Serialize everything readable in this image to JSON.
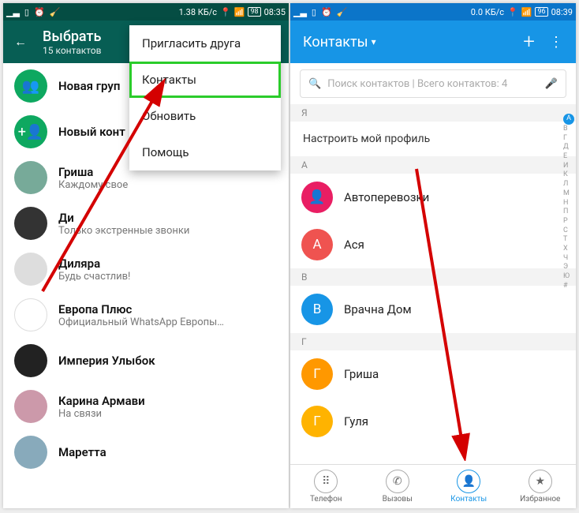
{
  "left": {
    "status": {
      "speed": "1.38 КБ/с",
      "battery": "98",
      "time": "08:35"
    },
    "header": {
      "title": "Выбрать",
      "subtitle": "15 контактов"
    },
    "menu": [
      "Пригласить друга",
      "Контакты",
      "Обновить",
      "Помощь"
    ],
    "rows": [
      {
        "name": "Новая груп",
        "status": "",
        "icon": "group"
      },
      {
        "name": "Новый конт",
        "status": "",
        "icon": "add"
      },
      {
        "name": "Гриша",
        "status": "Каждому свое"
      },
      {
        "name": "Ди",
        "status": "Только экстренные звонки"
      },
      {
        "name": "Диляра",
        "status": "Будь счастлив!"
      },
      {
        "name": "Европа Плюс",
        "status": "Официальный WhatsApp Европы…"
      },
      {
        "name": "Империя Улыбок",
        "status": ""
      },
      {
        "name": "Карина Армави",
        "status": "На связи"
      },
      {
        "name": "Маретта",
        "status": ""
      }
    ]
  },
  "right": {
    "status": {
      "speed": "0.0 КБ/с",
      "battery": "96",
      "time": "08:39"
    },
    "header": {
      "title": "Контакты"
    },
    "search_placeholder": "Поиск контактов | Всего контактов: 4",
    "setup_profile": "Настроить мой профиль",
    "sections": [
      {
        "letter": "Я",
        "items": []
      },
      {
        "letter": "А",
        "items": [
          {
            "name": "Автоперевозки",
            "color": "#e91e63"
          },
          {
            "name": "Ася",
            "color": "#ef5350"
          }
        ]
      },
      {
        "letter": "В",
        "items": [
          {
            "name": "Врачна Дом",
            "color": "#1795e6"
          }
        ]
      },
      {
        "letter": "Г",
        "items": [
          {
            "name": "Гриша",
            "color": "#ff9800"
          },
          {
            "name": "Гуля",
            "color": "#ffb300"
          }
        ]
      }
    ],
    "alpha": [
      "А",
      "В",
      "Г",
      "Д",
      "Е",
      "И",
      "К",
      "Л",
      "М",
      "Н",
      "П",
      "Р",
      "С",
      "Т",
      "Х",
      "Ч",
      "Э",
      "Ю",
      "#"
    ],
    "bottom": [
      {
        "label": "Телефон",
        "icon": "⠿"
      },
      {
        "label": "Вызовы",
        "icon": "✆"
      },
      {
        "label": "Контакты",
        "icon": "👤",
        "active": true
      },
      {
        "label": "Избранное",
        "icon": "★"
      }
    ]
  }
}
